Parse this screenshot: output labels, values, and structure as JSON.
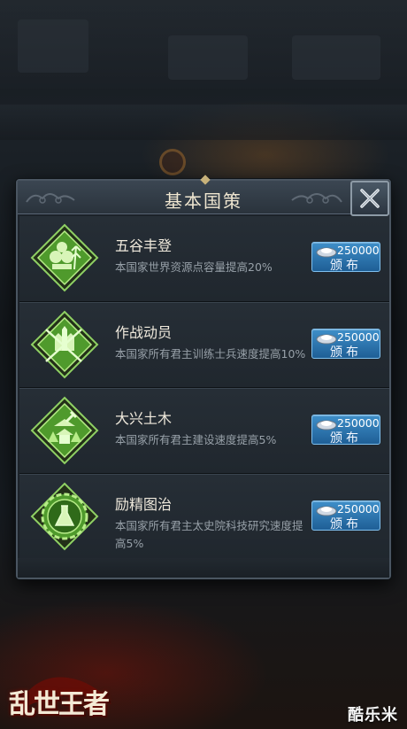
{
  "panel": {
    "title": "基本国策",
    "close_icon": "close-x-icon"
  },
  "policies": [
    {
      "name": "五谷丰登",
      "desc": "本国家世界资源点容量提高20%",
      "icon": "grain-harvest-icon",
      "cost": "250000",
      "button_label": "颁布"
    },
    {
      "name": "作战动员",
      "desc": "本国家所有君主训练士兵速度提高10%",
      "icon": "crossed-spears-castle-icon",
      "cost": "250000",
      "button_label": "颁布"
    },
    {
      "name": "大兴土木",
      "desc": "本国家所有君主建设速度提高5%",
      "icon": "pagoda-hammer-icon",
      "cost": "250000",
      "button_label": "颁布"
    },
    {
      "name": "励精图治",
      "desc": "本国家所有君主太史院科技研究速度提高5%",
      "icon": "research-flask-gear-icon",
      "cost": "250000",
      "button_label": "颁布"
    }
  ],
  "currency_icon": "silver-ingot-icon",
  "game_logo": "乱世王者",
  "watermark": "酷乐米",
  "colors": {
    "button_blue": "#2f79b5",
    "icon_green": "#5fb33a",
    "panel_bg": "#1c2229"
  }
}
